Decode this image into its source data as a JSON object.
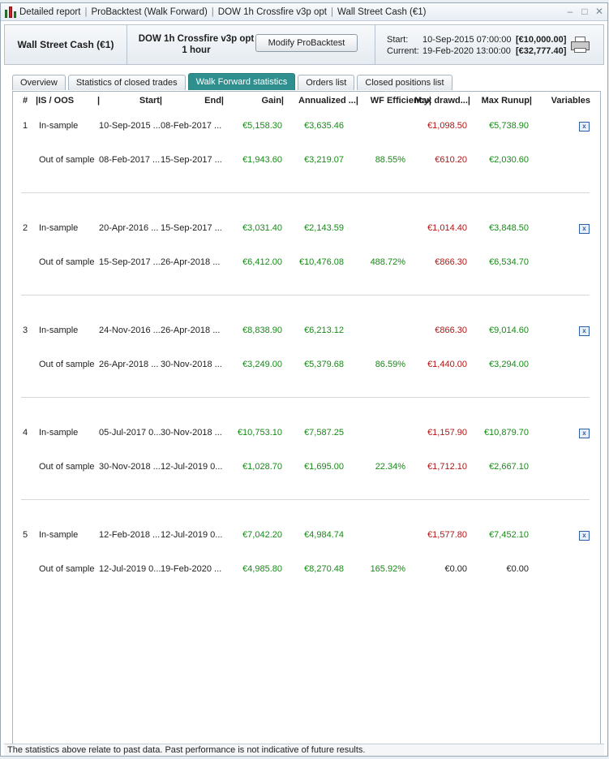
{
  "window": {
    "title_parts": [
      "Detailed report",
      "ProBacktest (Walk Forward)",
      "DOW 1h Crossfire v3p opt",
      "Wall Street Cash (€1)"
    ],
    "controls": [
      "–",
      "□",
      "✕"
    ]
  },
  "header": {
    "instrument": "Wall Street Cash (€1)",
    "strategy_name": "DOW 1h Crossfire v3p opt",
    "timeframe": "1 hour",
    "modify_button": "Modify ProBacktest",
    "start_label": "Start:",
    "start_date": "10-Sep-2015 07:00:00",
    "start_value": "[€10,000.00]",
    "current_label": "Current:",
    "current_date": "19-Feb-2020 13:00:00",
    "current_value": "[€32,777.40]"
  },
  "tabs": [
    {
      "label": "Overview",
      "active": false
    },
    {
      "label": "Statistics of closed trades",
      "active": false
    },
    {
      "label": "Walk Forward statistics",
      "active": true
    },
    {
      "label": "Orders list",
      "active": false
    },
    {
      "label": "Closed positions list",
      "active": false
    }
  ],
  "table": {
    "columns": [
      "#",
      "|IS / OOS",
      "|",
      "Start|",
      "End|",
      "Gain|",
      "Annualized ...|",
      "WF Efficiency|",
      "Max drawd...|",
      "Max Runup|",
      "Variables"
    ],
    "groups": [
      {
        "index": "1",
        "rows": [
          {
            "type": "In-sample",
            "start": "10-Sep-2015 ...",
            "end": "08-Feb-2017 ...",
            "gain": "€5,158.30",
            "annualized": "€3,635.46",
            "wf": "",
            "drawdown": "€1,098.50",
            "runup": "€5,738.90"
          },
          {
            "type": "Out of sample",
            "start": "08-Feb-2017 ...",
            "end": "15-Sep-2017 ...",
            "gain": "€1,943.60",
            "annualized": "€3,219.07",
            "wf": "88.55%",
            "drawdown": "€610.20",
            "runup": "€2,030.60"
          }
        ]
      },
      {
        "index": "2",
        "rows": [
          {
            "type": "In-sample",
            "start": "20-Apr-2016 ...",
            "end": "15-Sep-2017 ...",
            "gain": "€3,031.40",
            "annualized": "€2,143.59",
            "wf": "",
            "drawdown": "€1,014.40",
            "runup": "€3,848.50"
          },
          {
            "type": "Out of sample",
            "start": "15-Sep-2017 ...",
            "end": "26-Apr-2018 ...",
            "gain": "€6,412.00",
            "annualized": "€10,476.08",
            "wf": "488.72%",
            "drawdown": "€866.30",
            "runup": "€6,534.70"
          }
        ]
      },
      {
        "index": "3",
        "rows": [
          {
            "type": "In-sample",
            "start": "24-Nov-2016 ...",
            "end": "26-Apr-2018 ...",
            "gain": "€8,838.90",
            "annualized": "€6,213.12",
            "wf": "",
            "drawdown": "€866.30",
            "runup": "€9,014.60"
          },
          {
            "type": "Out of sample",
            "start": "26-Apr-2018 ...",
            "end": "30-Nov-2018 ...",
            "gain": "€3,249.00",
            "annualized": "€5,379.68",
            "wf": "86.59%",
            "drawdown": "€1,440.00",
            "runup": "€3,294.00"
          }
        ]
      },
      {
        "index": "4",
        "rows": [
          {
            "type": "In-sample",
            "start": "05-Jul-2017 0...",
            "end": "30-Nov-2018 ...",
            "gain": "€10,753.10",
            "annualized": "€7,587.25",
            "wf": "",
            "drawdown": "€1,157.90",
            "runup": "€10,879.70"
          },
          {
            "type": "Out of sample",
            "start": "30-Nov-2018 ...",
            "end": "12-Jul-2019 0...",
            "gain": "€1,028.70",
            "annualized": "€1,695.00",
            "wf": "22.34%",
            "drawdown": "€1,712.10",
            "runup": "€2,667.10"
          }
        ]
      },
      {
        "index": "5",
        "rows": [
          {
            "type": "In-sample",
            "start": "12-Feb-2018 ...",
            "end": "12-Jul-2019 0...",
            "gain": "€7,042.20",
            "annualized": "€4,984.74",
            "wf": "",
            "drawdown": "€1,577.80",
            "runup": "€7,452.10"
          },
          {
            "type": "Out of sample",
            "start": "12-Jul-2019 0...",
            "end": "19-Feb-2020 ...",
            "gain": "€4,985.80",
            "annualized": "€8,270.48",
            "wf": "165.92%",
            "drawdown": "€0.00",
            "runup": "€0.00"
          }
        ]
      }
    ]
  },
  "footer": {
    "disclaimer": "The statistics above relate to past data. Past performance is not indicative of future results."
  }
}
